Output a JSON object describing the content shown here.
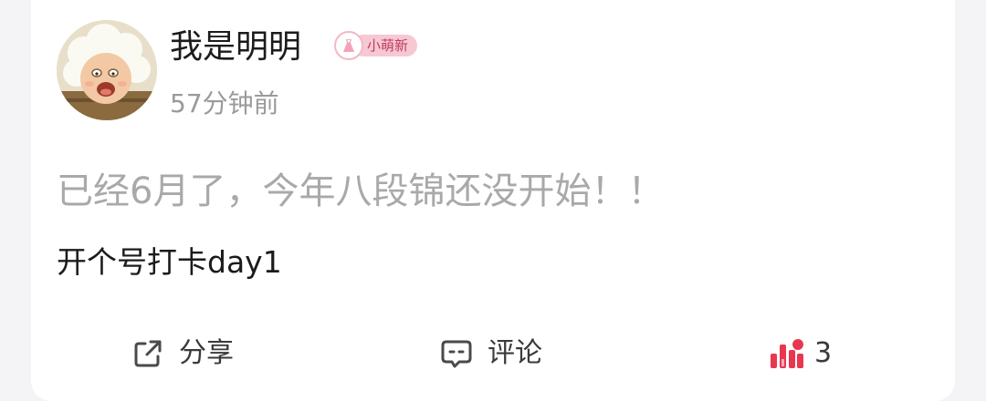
{
  "author": {
    "name": "我是明明",
    "badge_label": "小萌新",
    "time": "57分钟前"
  },
  "post": {
    "title": "已经6月了，今年八段锦还没开始！！",
    "body": "开个号打卡day1"
  },
  "actions": {
    "share_label": "分享",
    "comment_label": "评论",
    "like_count": "3"
  },
  "icons": {
    "share": "share-icon",
    "comment": "comment-icon",
    "like": "like-icon",
    "badge": "dress-icon"
  },
  "colors": {
    "like_accent": "#e8374f",
    "badge_bg": "#f6c8d4",
    "badge_text": "#c03a5e",
    "muted_text": "#9a9a9a"
  }
}
